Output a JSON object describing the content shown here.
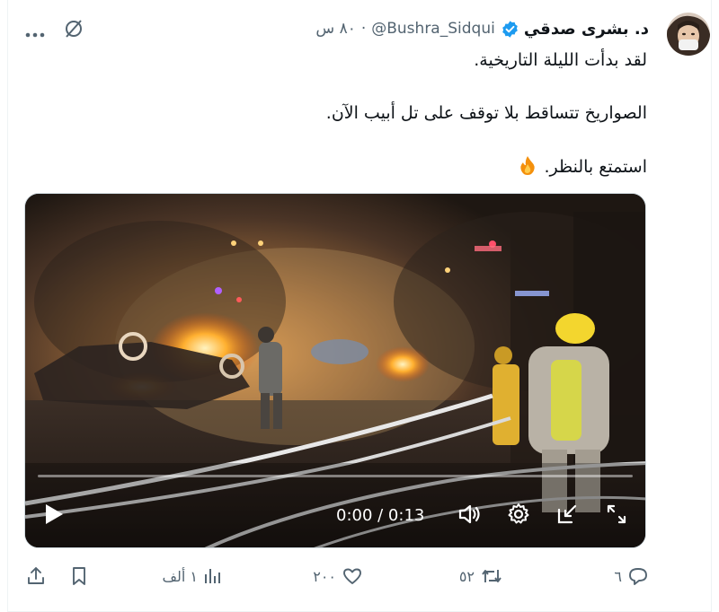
{
  "tweet": {
    "author_name": "د. بشرى صدقي",
    "handle": "@Bushra_Sidqui",
    "separator": "·",
    "time": "٨٠ س",
    "lines": [
      "لقد بدأت الليلة التاريخية.",
      "الصواريخ تتساقط بلا توقف على تل أبيب الآن.",
      "استمتع بالنظر."
    ]
  },
  "video": {
    "time_display": "0:00 / 0:13",
    "progress": 0
  },
  "actions": {
    "replies": "٦",
    "reposts": "٥٢",
    "likes": "٢٠٠",
    "views": "١ ألف"
  },
  "colors": {
    "verified": "#1d9bf0",
    "text": "#0f1419",
    "muted": "#536471"
  }
}
